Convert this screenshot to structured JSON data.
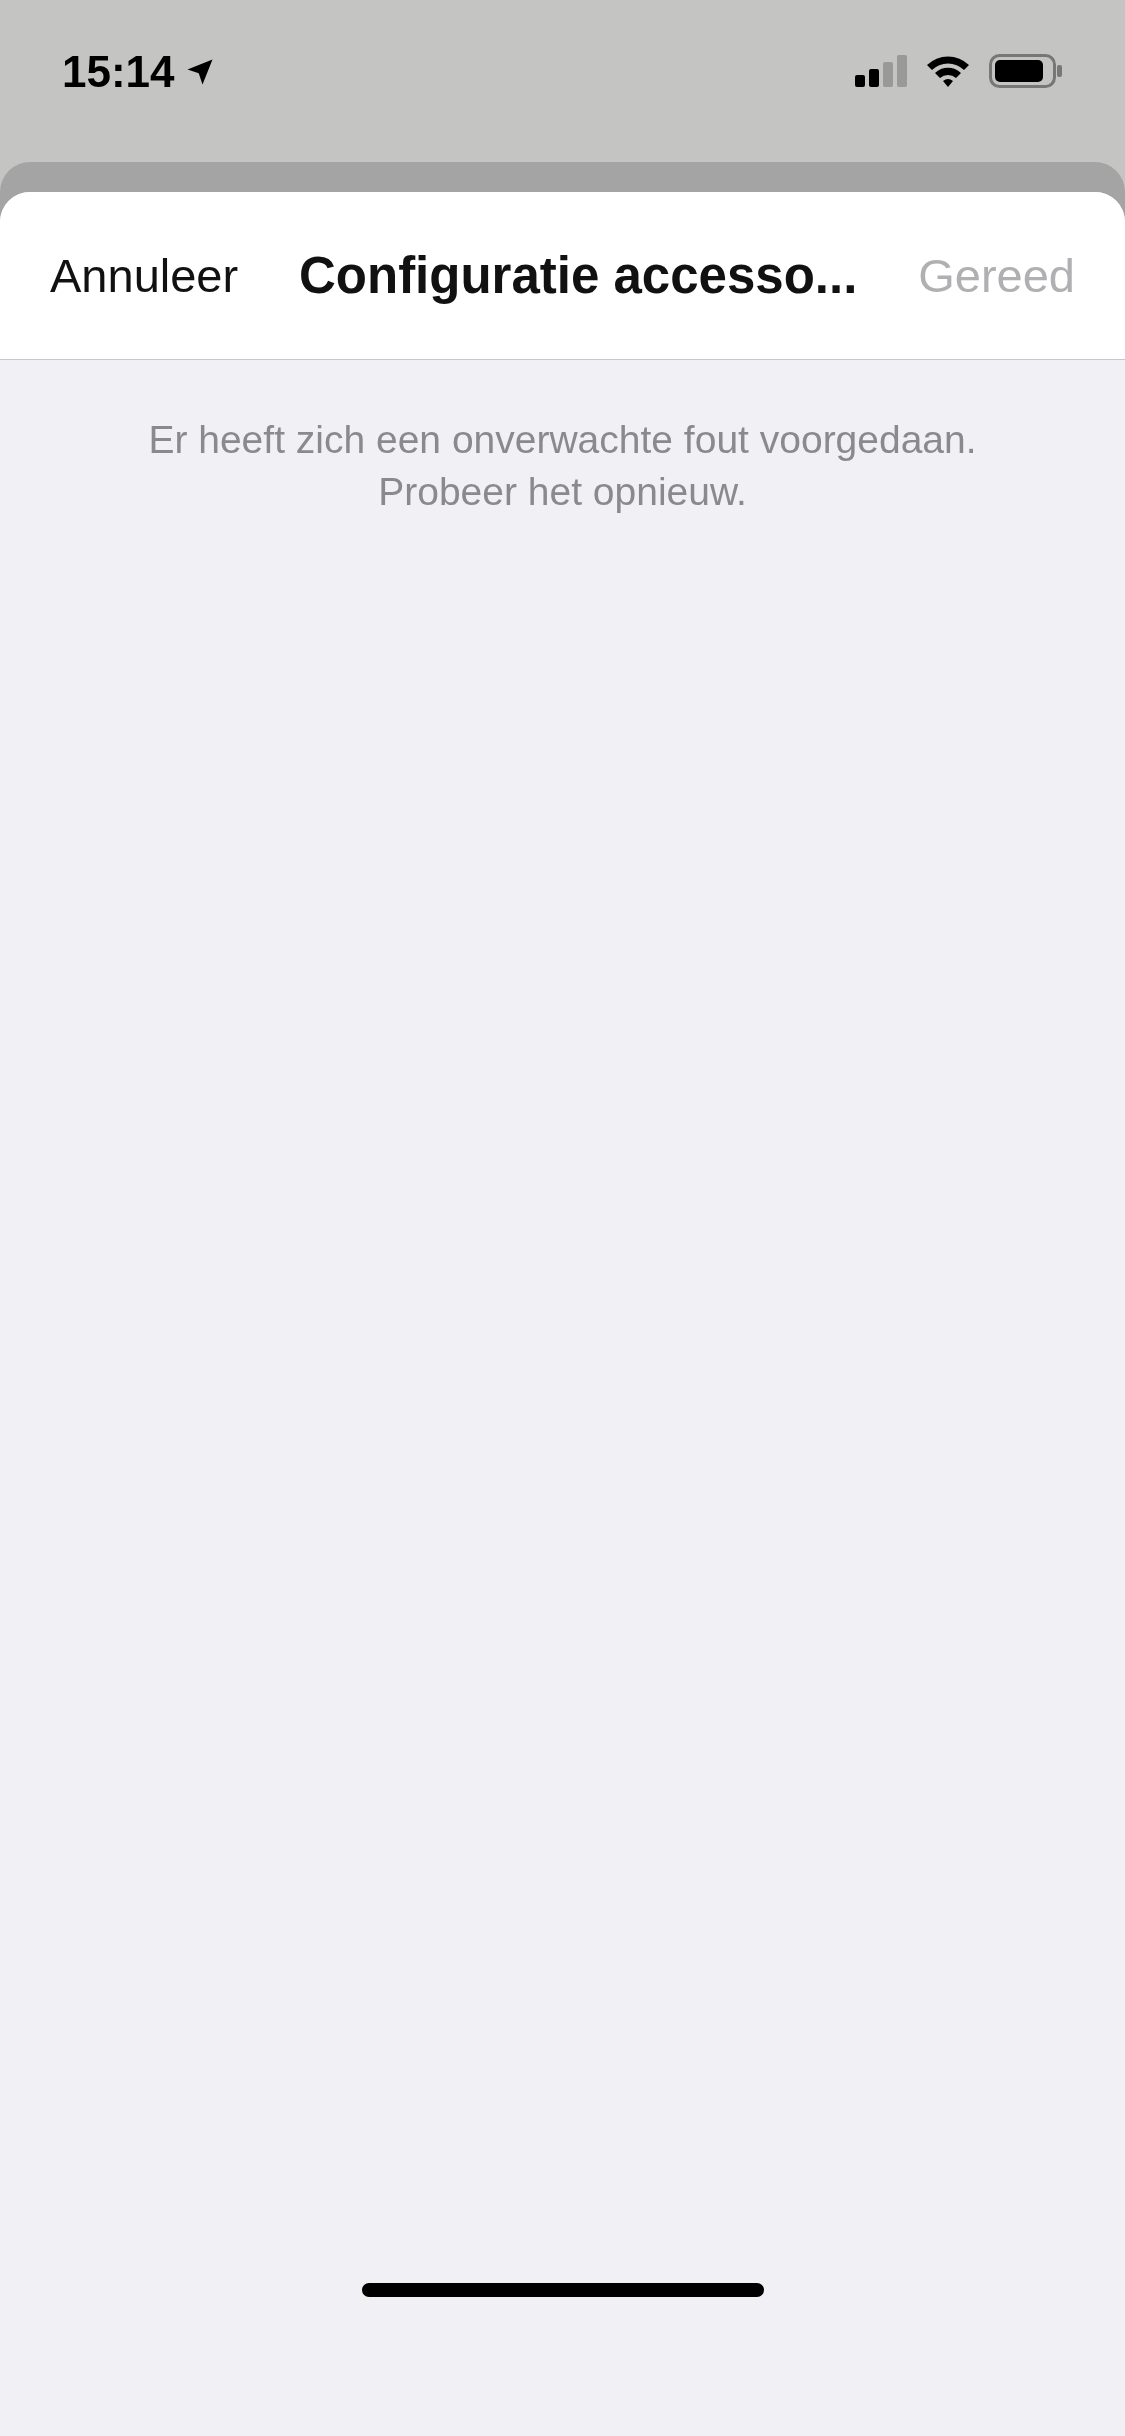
{
  "status_bar": {
    "time": "15:14"
  },
  "sheet": {
    "cancel": "Annuleer",
    "title": "Configuratie accesso...",
    "done": {
      "label": "Gereed",
      "disabled": true
    },
    "message": "Er heeft zich een onverwachte fout voorgedaan. Probeer het opnieuw."
  }
}
